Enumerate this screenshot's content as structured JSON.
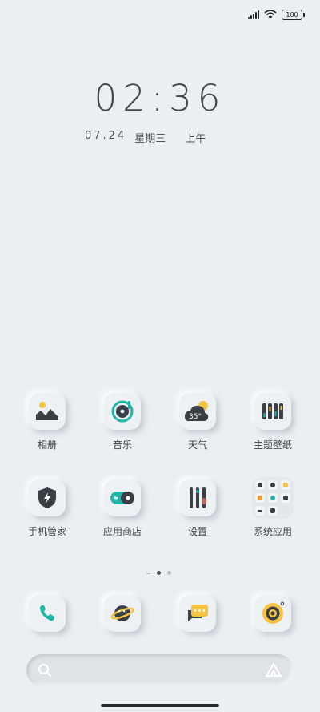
{
  "status_bar": {
    "battery": "100",
    "signal_icon": "signal-bars-icon",
    "wifi_icon": "wifi-icon"
  },
  "lock": {
    "time": "02:36",
    "date": "07.24",
    "weekday": "星期三",
    "period": "上午"
  },
  "apps_row1": [
    {
      "label": "相册",
      "icon": "gallery-icon"
    },
    {
      "label": "音乐",
      "icon": "music-icon"
    },
    {
      "label": "天气",
      "icon": "weather-icon",
      "temp": "35°"
    },
    {
      "label": "主题壁纸",
      "icon": "themes-icon"
    }
  ],
  "apps_row2": [
    {
      "label": "手机管家",
      "icon": "security-icon"
    },
    {
      "label": "应用商店",
      "icon": "app-store-icon"
    },
    {
      "label": "设置",
      "icon": "settings-icon"
    },
    {
      "label": "系统应用",
      "icon": "folder-icon"
    }
  ],
  "dock": [
    {
      "icon": "phone-icon"
    },
    {
      "icon": "browser-icon"
    },
    {
      "icon": "messages-icon"
    },
    {
      "icon": "camera-icon"
    }
  ],
  "colors": {
    "teal": "#1fb5a8",
    "yellow": "#f6c343",
    "dark": "#2f3338",
    "background": "#eceff2"
  }
}
